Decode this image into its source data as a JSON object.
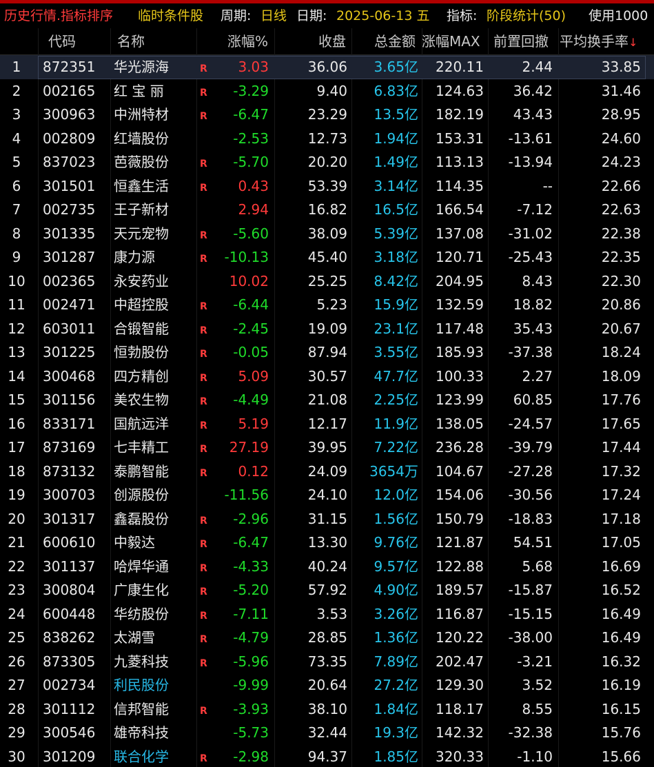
{
  "title_bar": {
    "title": "历史行情.指标排序",
    "condition": "临时条件股",
    "period_label": "周期:",
    "period_value": "日线",
    "date_label": "日期:",
    "date_value": "2025-06-13 五",
    "indicator_label": "指标:",
    "indicator_value": "阶段统计(50)",
    "usage_text": "使用1000"
  },
  "columns": {
    "code": "代码",
    "name": "名称",
    "change_pct": "涨幅%",
    "close": "收盘",
    "amount": "总金额",
    "max_change": "涨幅MAX",
    "drawdown": "前置回撤",
    "turnover": "平均换手率",
    "sort_arrow": "↓"
  },
  "colors": {
    "title_red": "#ff3a3a",
    "title_yellow": "#e6c619",
    "up": "#ff3a3a",
    "down": "#1fdc2a",
    "amount": "#27c4ea",
    "header_text": "#c8c8c8"
  },
  "rows": [
    {
      "idx": "1",
      "code": "872351",
      "name": "华光源海",
      "r": "R",
      "chg": "3.03",
      "dir": "up",
      "close": "36.06",
      "amount": "3.65亿",
      "max": "220.11",
      "dd": "2.44",
      "turn": "33.85",
      "selected": true
    },
    {
      "idx": "2",
      "code": "002165",
      "name": "红 宝 丽",
      "r": "R",
      "chg": "-3.29",
      "dir": "down",
      "close": "9.40",
      "amount": "6.83亿",
      "max": "124.63",
      "dd": "36.42",
      "turn": "31.46"
    },
    {
      "idx": "3",
      "code": "300963",
      "name": "中洲特材",
      "r": "R",
      "chg": "-6.47",
      "dir": "down",
      "close": "23.29",
      "amount": "13.5亿",
      "max": "182.19",
      "dd": "43.43",
      "turn": "28.95"
    },
    {
      "idx": "4",
      "code": "002809",
      "name": "红墙股份",
      "r": "",
      "chg": "-2.53",
      "dir": "down",
      "close": "12.73",
      "amount": "1.94亿",
      "max": "153.31",
      "dd": "-13.61",
      "turn": "24.60"
    },
    {
      "idx": "5",
      "code": "837023",
      "name": "芭薇股份",
      "r": "R",
      "chg": "-5.70",
      "dir": "down",
      "close": "20.20",
      "amount": "1.49亿",
      "max": "113.13",
      "dd": "-13.94",
      "turn": "24.23"
    },
    {
      "idx": "6",
      "code": "301501",
      "name": "恒鑫生活",
      "r": "R",
      "chg": "0.43",
      "dir": "up",
      "close": "53.39",
      "amount": "3.14亿",
      "max": "114.35",
      "dd": "--",
      "turn": "22.66"
    },
    {
      "idx": "7",
      "code": "002735",
      "name": "王子新材",
      "r": "",
      "chg": "2.94",
      "dir": "up",
      "close": "16.82",
      "amount": "16.5亿",
      "max": "166.54",
      "dd": "-7.12",
      "turn": "22.63"
    },
    {
      "idx": "8",
      "code": "301335",
      "name": "天元宠物",
      "r": "R",
      "chg": "-5.60",
      "dir": "down",
      "close": "38.09",
      "amount": "5.39亿",
      "max": "137.08",
      "dd": "-31.02",
      "turn": "22.38"
    },
    {
      "idx": "9",
      "code": "301287",
      "name": "康力源",
      "r": "R",
      "chg": "-10.13",
      "dir": "down",
      "close": "45.40",
      "amount": "3.18亿",
      "max": "120.71",
      "dd": "-25.43",
      "turn": "22.35"
    },
    {
      "idx": "10",
      "code": "002365",
      "name": "永安药业",
      "r": "",
      "chg": "10.02",
      "dir": "up",
      "close": "25.25",
      "amount": "8.42亿",
      "max": "204.95",
      "dd": "8.43",
      "turn": "22.30"
    },
    {
      "idx": "11",
      "code": "002471",
      "name": "中超控股",
      "r": "R",
      "chg": "-6.44",
      "dir": "down",
      "close": "5.23",
      "amount": "15.9亿",
      "max": "132.59",
      "dd": "18.82",
      "turn": "20.86"
    },
    {
      "idx": "12",
      "code": "603011",
      "name": "合锻智能",
      "r": "R",
      "chg": "-2.45",
      "dir": "down",
      "close": "19.09",
      "amount": "23.1亿",
      "max": "117.48",
      "dd": "35.43",
      "turn": "20.67"
    },
    {
      "idx": "13",
      "code": "301225",
      "name": "恒勃股份",
      "r": "R",
      "chg": "-0.05",
      "dir": "down",
      "close": "87.94",
      "amount": "3.55亿",
      "max": "185.93",
      "dd": "-37.38",
      "turn": "18.24"
    },
    {
      "idx": "14",
      "code": "300468",
      "name": "四方精创",
      "r": "R",
      "chg": "5.09",
      "dir": "up",
      "close": "30.57",
      "amount": "47.7亿",
      "max": "100.33",
      "dd": "2.27",
      "turn": "18.09"
    },
    {
      "idx": "15",
      "code": "301156",
      "name": "美农生物",
      "r": "R",
      "chg": "-4.49",
      "dir": "down",
      "close": "21.08",
      "amount": "2.25亿",
      "max": "123.99",
      "dd": "60.85",
      "turn": "17.76"
    },
    {
      "idx": "16",
      "code": "833171",
      "name": "国航远洋",
      "r": "R",
      "chg": "5.19",
      "dir": "up",
      "close": "12.17",
      "amount": "11.9亿",
      "max": "138.05",
      "dd": "-24.57",
      "turn": "17.65"
    },
    {
      "idx": "17",
      "code": "873169",
      "name": "七丰精工",
      "r": "R",
      "chg": "27.19",
      "dir": "up",
      "close": "39.95",
      "amount": "7.22亿",
      "max": "236.28",
      "dd": "-39.79",
      "turn": "17.44"
    },
    {
      "idx": "18",
      "code": "873132",
      "name": "泰鹏智能",
      "r": "R",
      "chg": "0.12",
      "dir": "up",
      "close": "24.09",
      "amount": "3654万",
      "max": "104.67",
      "dd": "-27.28",
      "turn": "17.32"
    },
    {
      "idx": "19",
      "code": "300703",
      "name": "创源股份",
      "r": "",
      "chg": "-11.56",
      "dir": "down",
      "close": "24.10",
      "amount": "12.0亿",
      "max": "154.06",
      "dd": "-30.56",
      "turn": "17.24"
    },
    {
      "idx": "20",
      "code": "301317",
      "name": "鑫磊股份",
      "r": "R",
      "chg": "-2.96",
      "dir": "down",
      "close": "31.15",
      "amount": "1.56亿",
      "max": "150.79",
      "dd": "-18.83",
      "turn": "17.18"
    },
    {
      "idx": "21",
      "code": "600610",
      "name": "中毅达",
      "r": "R",
      "chg": "-6.47",
      "dir": "down",
      "close": "13.30",
      "amount": "9.76亿",
      "max": "121.87",
      "dd": "54.51",
      "turn": "17.05"
    },
    {
      "idx": "22",
      "code": "301137",
      "name": "哈焊华通",
      "r": "R",
      "chg": "-4.33",
      "dir": "down",
      "close": "40.24",
      "amount": "9.57亿",
      "max": "122.88",
      "dd": "5.68",
      "turn": "16.69"
    },
    {
      "idx": "23",
      "code": "300804",
      "name": "广康生化",
      "r": "R",
      "chg": "-5.20",
      "dir": "down",
      "close": "57.92",
      "amount": "4.90亿",
      "max": "189.57",
      "dd": "-15.87",
      "turn": "16.52"
    },
    {
      "idx": "24",
      "code": "600448",
      "name": "华纺股份",
      "r": "R",
      "chg": "-7.11",
      "dir": "down",
      "close": "3.53",
      "amount": "3.26亿",
      "max": "116.87",
      "dd": "-15.15",
      "turn": "16.49"
    },
    {
      "idx": "25",
      "code": "838262",
      "name": "太湖雪",
      "r": "R",
      "chg": "-4.79",
      "dir": "down",
      "close": "28.85",
      "amount": "1.36亿",
      "max": "120.22",
      "dd": "-38.00",
      "turn": "16.49"
    },
    {
      "idx": "26",
      "code": "873305",
      "name": "九菱科技",
      "r": "R",
      "chg": "-5.96",
      "dir": "down",
      "close": "73.35",
      "amount": "7.89亿",
      "max": "202.47",
      "dd": "-3.21",
      "turn": "16.32"
    },
    {
      "idx": "27",
      "code": "002734",
      "name": "利民股份",
      "r": "",
      "chg": "-9.99",
      "dir": "down",
      "close": "20.64",
      "amount": "27.2亿",
      "max": "129.30",
      "dd": "3.52",
      "turn": "16.19",
      "name_blue": true
    },
    {
      "idx": "28",
      "code": "301112",
      "name": "信邦智能",
      "r": "R",
      "chg": "-3.93",
      "dir": "down",
      "close": "38.10",
      "amount": "1.84亿",
      "max": "118.17",
      "dd": "8.55",
      "turn": "16.15"
    },
    {
      "idx": "29",
      "code": "300546",
      "name": "雄帝科技",
      "r": "",
      "chg": "-5.73",
      "dir": "down",
      "close": "32.44",
      "amount": "19.3亿",
      "max": "142.32",
      "dd": "-32.38",
      "turn": "15.76"
    },
    {
      "idx": "30",
      "code": "301209",
      "name": "联合化学",
      "r": "R",
      "chg": "-2.98",
      "dir": "down",
      "close": "94.37",
      "amount": "1.85亿",
      "max": "320.33",
      "dd": "-1.10",
      "turn": "15.66",
      "name_blue": true
    }
  ]
}
